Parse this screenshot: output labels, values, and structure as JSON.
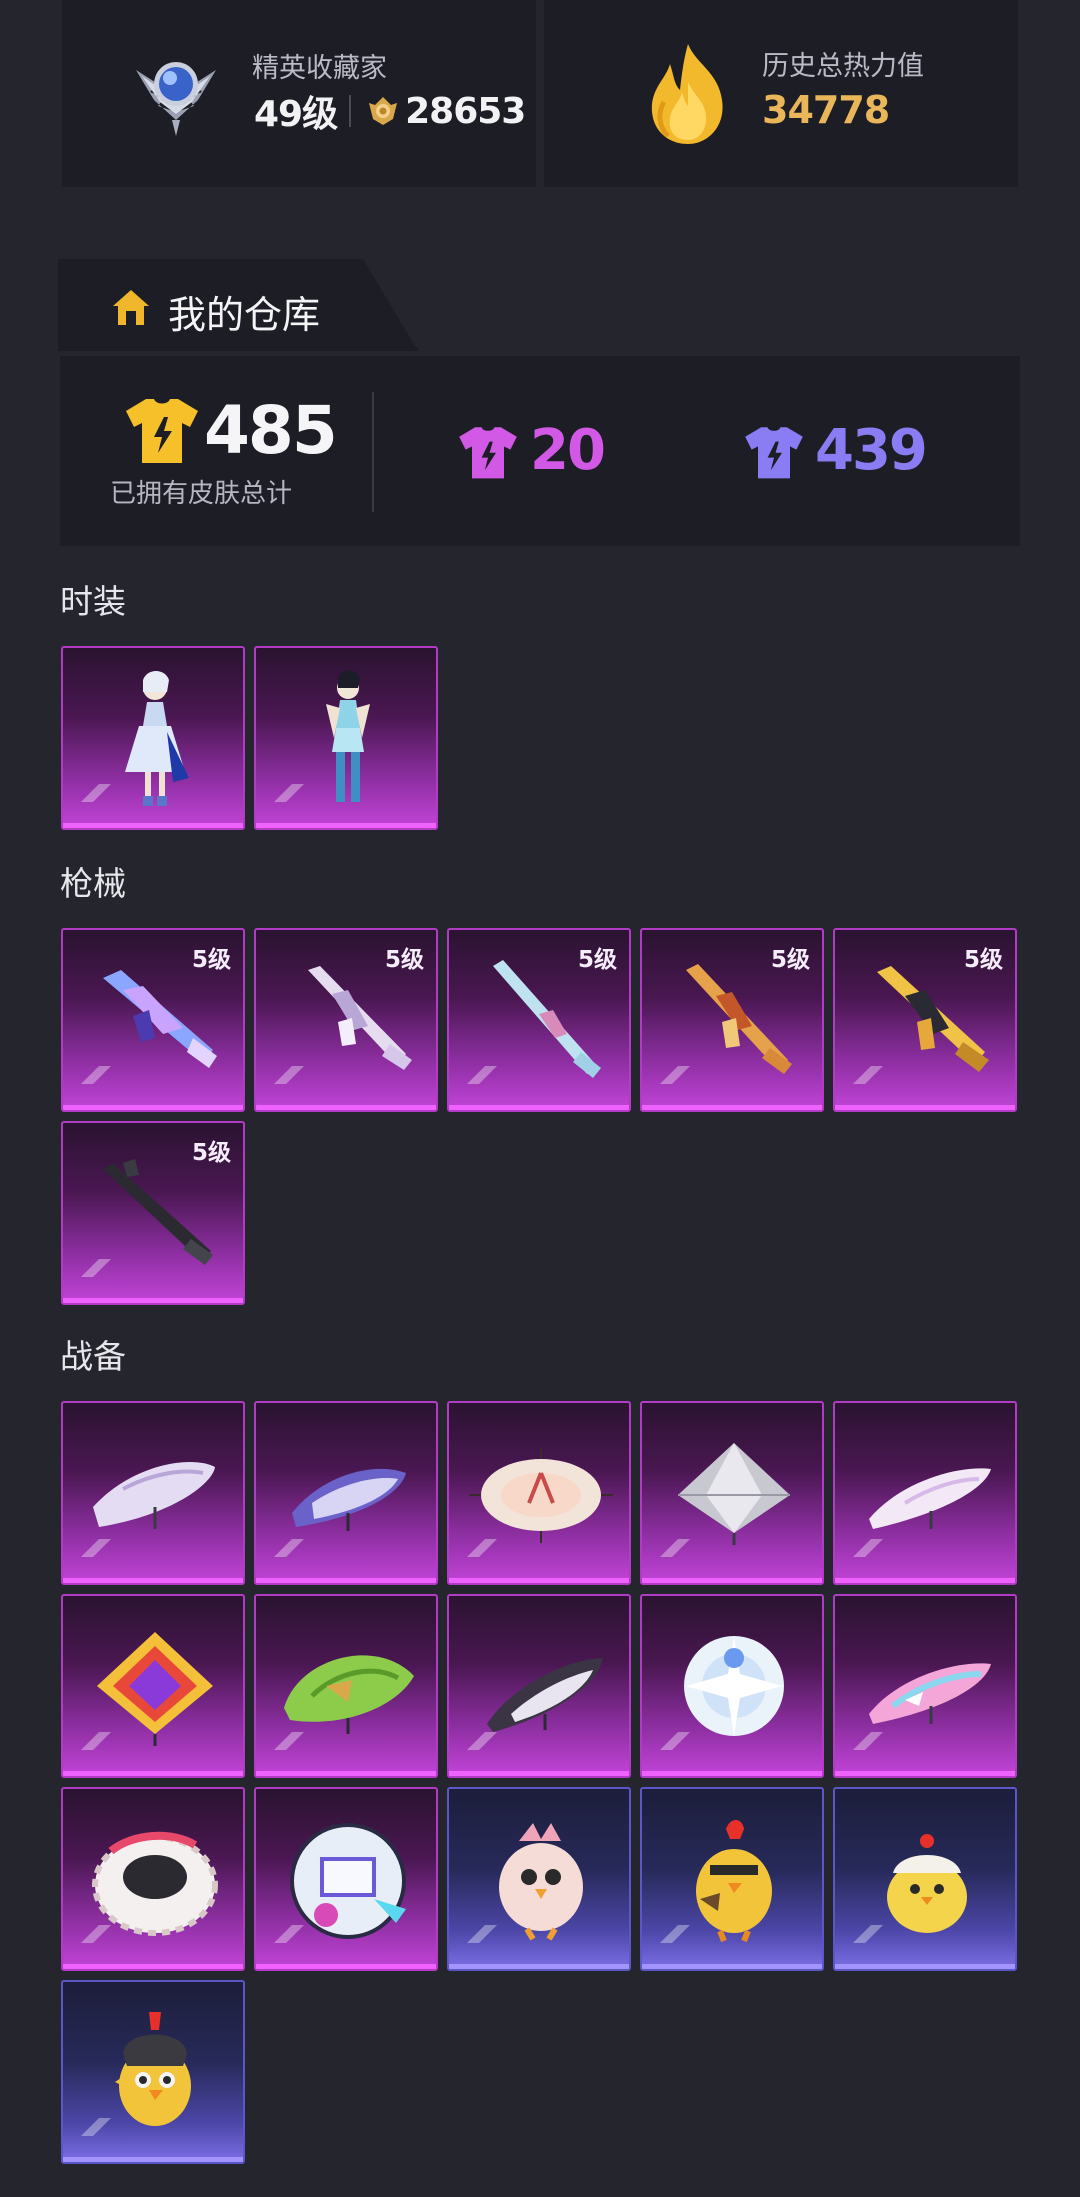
{
  "collector": {
    "title": "精英收藏家",
    "level": "49级",
    "points": "28653"
  },
  "heat": {
    "title": "历史总热力值",
    "value": "34778"
  },
  "warehouse": {
    "tab_label": "我的仓库",
    "total_count": "485",
    "total_label": "已拥有皮肤总计",
    "legendary_count": "20",
    "epic_count": "439"
  },
  "sections": {
    "fashion_title": "时装",
    "guns_title": "枪械",
    "gear_title": "战备"
  },
  "guns": {
    "levels": [
      "5级",
      "5级",
      "5级",
      "5级",
      "5级",
      "5级"
    ]
  },
  "colors": {
    "background": "#25252d",
    "panel": "#1c1d25",
    "gold": "#e9b65a",
    "legendary_pink": "#d258e6",
    "epic_purple": "#8a7cf2",
    "tile_magenta": "#c244d8",
    "tile_blue": "#4b46a6"
  },
  "icons": {
    "collector_badge": "winged-badge-icon",
    "coin": "coin-icon",
    "heat": "flame-icon",
    "warehouse": "house-icon",
    "skin_total": "tshirt-icon"
  }
}
